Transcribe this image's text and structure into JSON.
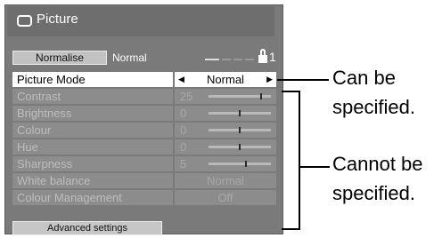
{
  "menu": {
    "title": "Picture",
    "normalise": {
      "button_label": "Normalise",
      "value": "Normal"
    },
    "lock_number": "1",
    "rows": [
      {
        "label": "Picture Mode",
        "value": "Normal"
      },
      {
        "label": "Contrast",
        "value": "25",
        "level": 0.85
      },
      {
        "label": "Brightness",
        "value": "0",
        "level": 0.5
      },
      {
        "label": "Colour",
        "value": "0",
        "level": 0.5
      },
      {
        "label": "Hue",
        "value": "0",
        "level": 0.5
      },
      {
        "label": "Sharpness",
        "value": "5",
        "level": 0.6
      },
      {
        "label": "White balance",
        "value": "Normal"
      },
      {
        "label": "Colour Management",
        "value": "Off"
      }
    ],
    "advanced_label": "Advanced settings"
  },
  "annotations": {
    "can_be": "Can be",
    "can_specified": "specified.",
    "cannot_be": "Cannot be",
    "cannot_specified": "specified."
  }
}
